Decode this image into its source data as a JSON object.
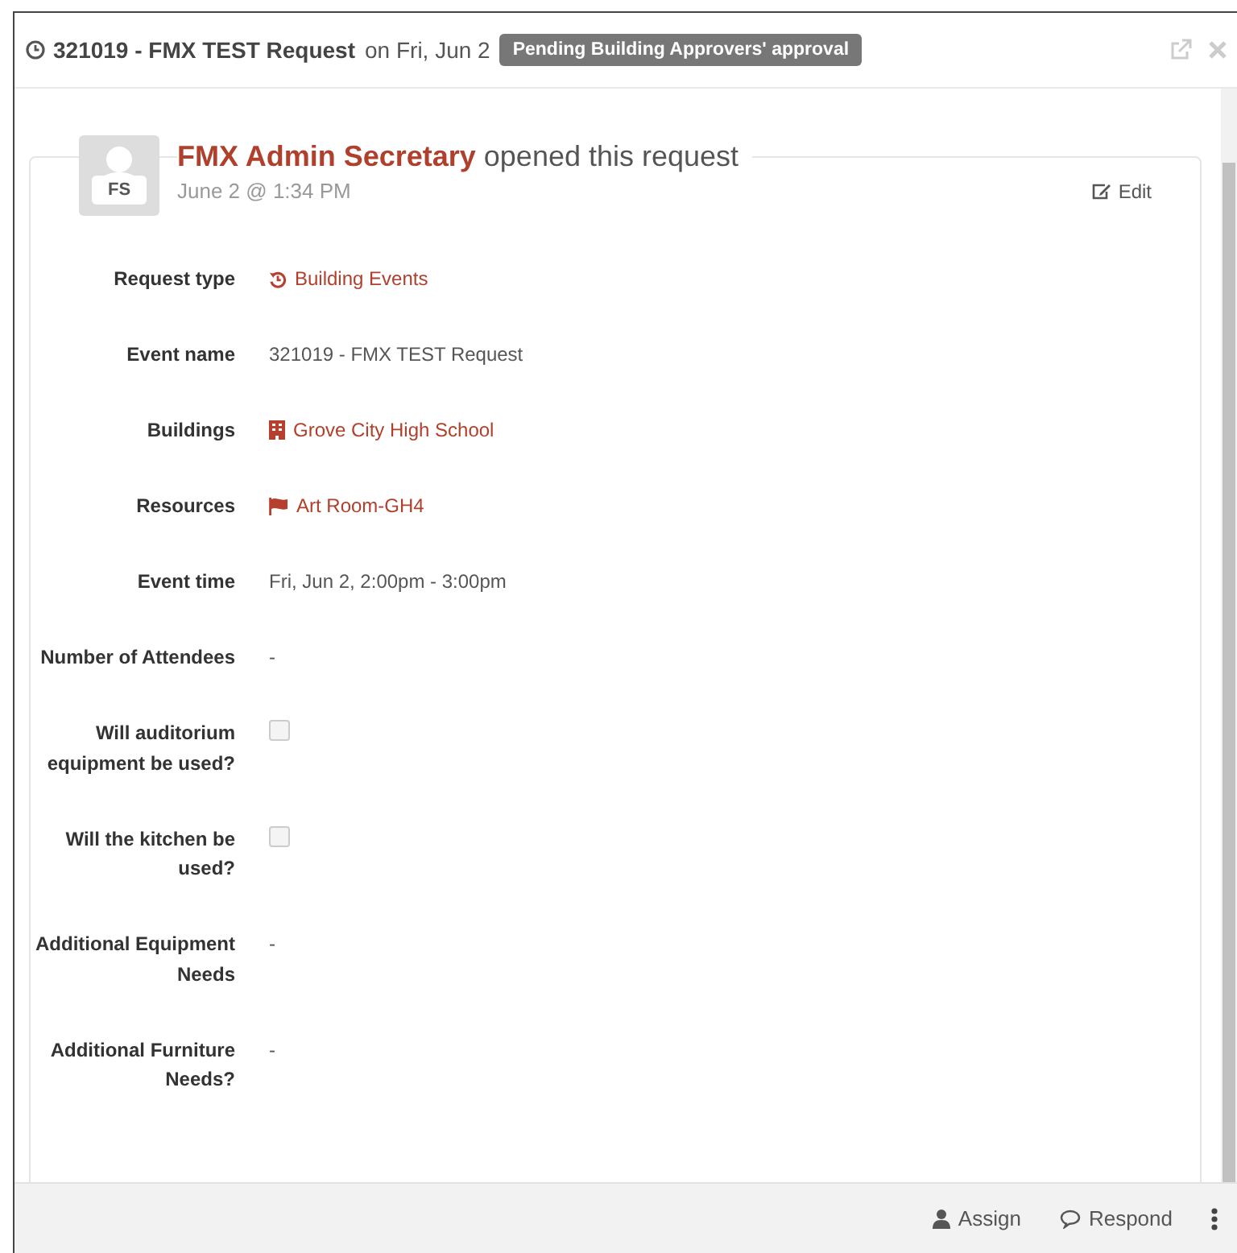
{
  "header": {
    "request_title": "321019 - FMX TEST Request",
    "date_text": "on Fri, Jun 2",
    "status_badge": "Pending Building Approvers' approval"
  },
  "opened": {
    "avatar_initials": "FS",
    "author": "FMX Admin Secretary",
    "action": "opened this request",
    "timestamp": "June 2 @ 1:34 PM",
    "edit_label": "Edit"
  },
  "fields": [
    {
      "label": "Request type",
      "kind": "type-link",
      "value": "Building Events"
    },
    {
      "label": "Event name",
      "kind": "text",
      "value": "321019 - FMX TEST Request"
    },
    {
      "label": "Buildings",
      "kind": "building-link",
      "value": "Grove City High School"
    },
    {
      "label": "Resources",
      "kind": "resource-link",
      "value": "Art Room-GH4"
    },
    {
      "label": "Event time",
      "kind": "text",
      "value": "Fri, Jun 2, 2:00pm - 3:00pm"
    },
    {
      "label": "Number of Attendees",
      "kind": "text",
      "value": "-"
    },
    {
      "label": "Will auditorium equipment be used?",
      "kind": "checkbox",
      "checked": false
    },
    {
      "label": "Will the kitchen be used?",
      "kind": "checkbox",
      "checked": false
    },
    {
      "label": "Additional Equipment Needs",
      "kind": "text",
      "value": "-"
    },
    {
      "label": "Additional Furniture Needs?",
      "kind": "text",
      "value": "-"
    }
  ],
  "footer": {
    "assign_label": "Assign",
    "respond_label": "Respond"
  }
}
